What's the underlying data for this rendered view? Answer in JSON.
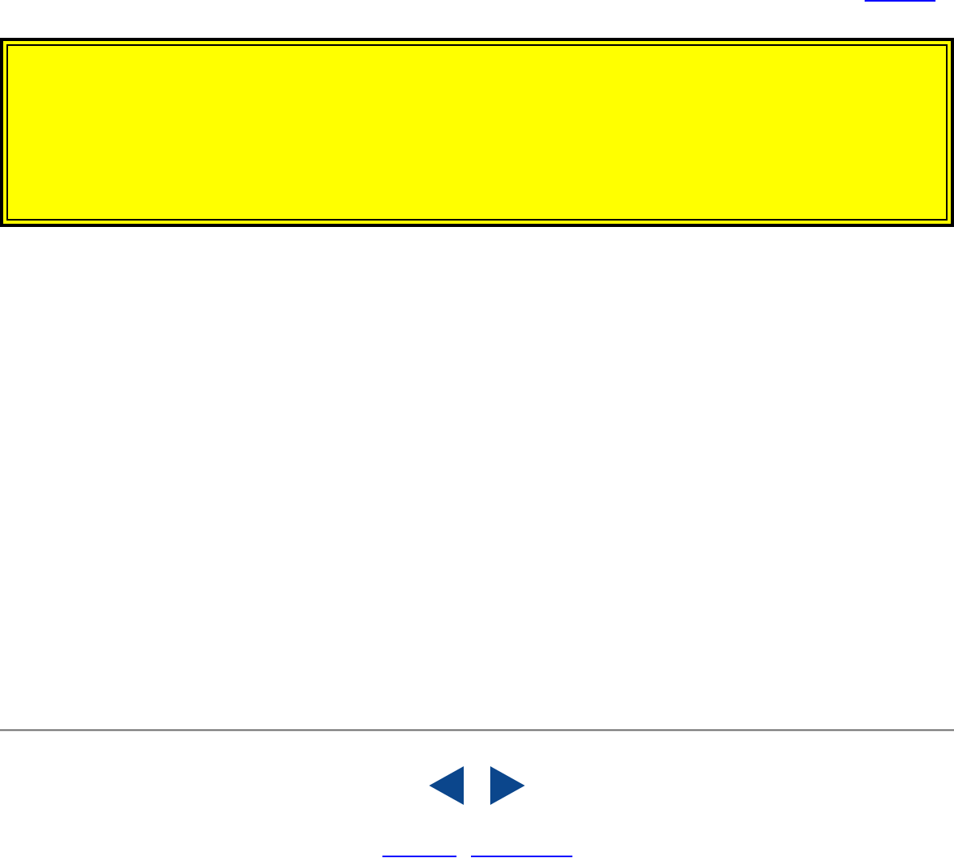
{
  "header": {
    "link": {
      "kind": "underline"
    }
  },
  "banner": {
    "kind": "notice"
  },
  "navigation": {
    "arrows": [
      {
        "kind": "previous"
      },
      {
        "kind": "next"
      }
    ]
  },
  "footer": {
    "links": [
      {
        "kind": "underline"
      },
      {
        "kind": "underline"
      }
    ]
  }
}
